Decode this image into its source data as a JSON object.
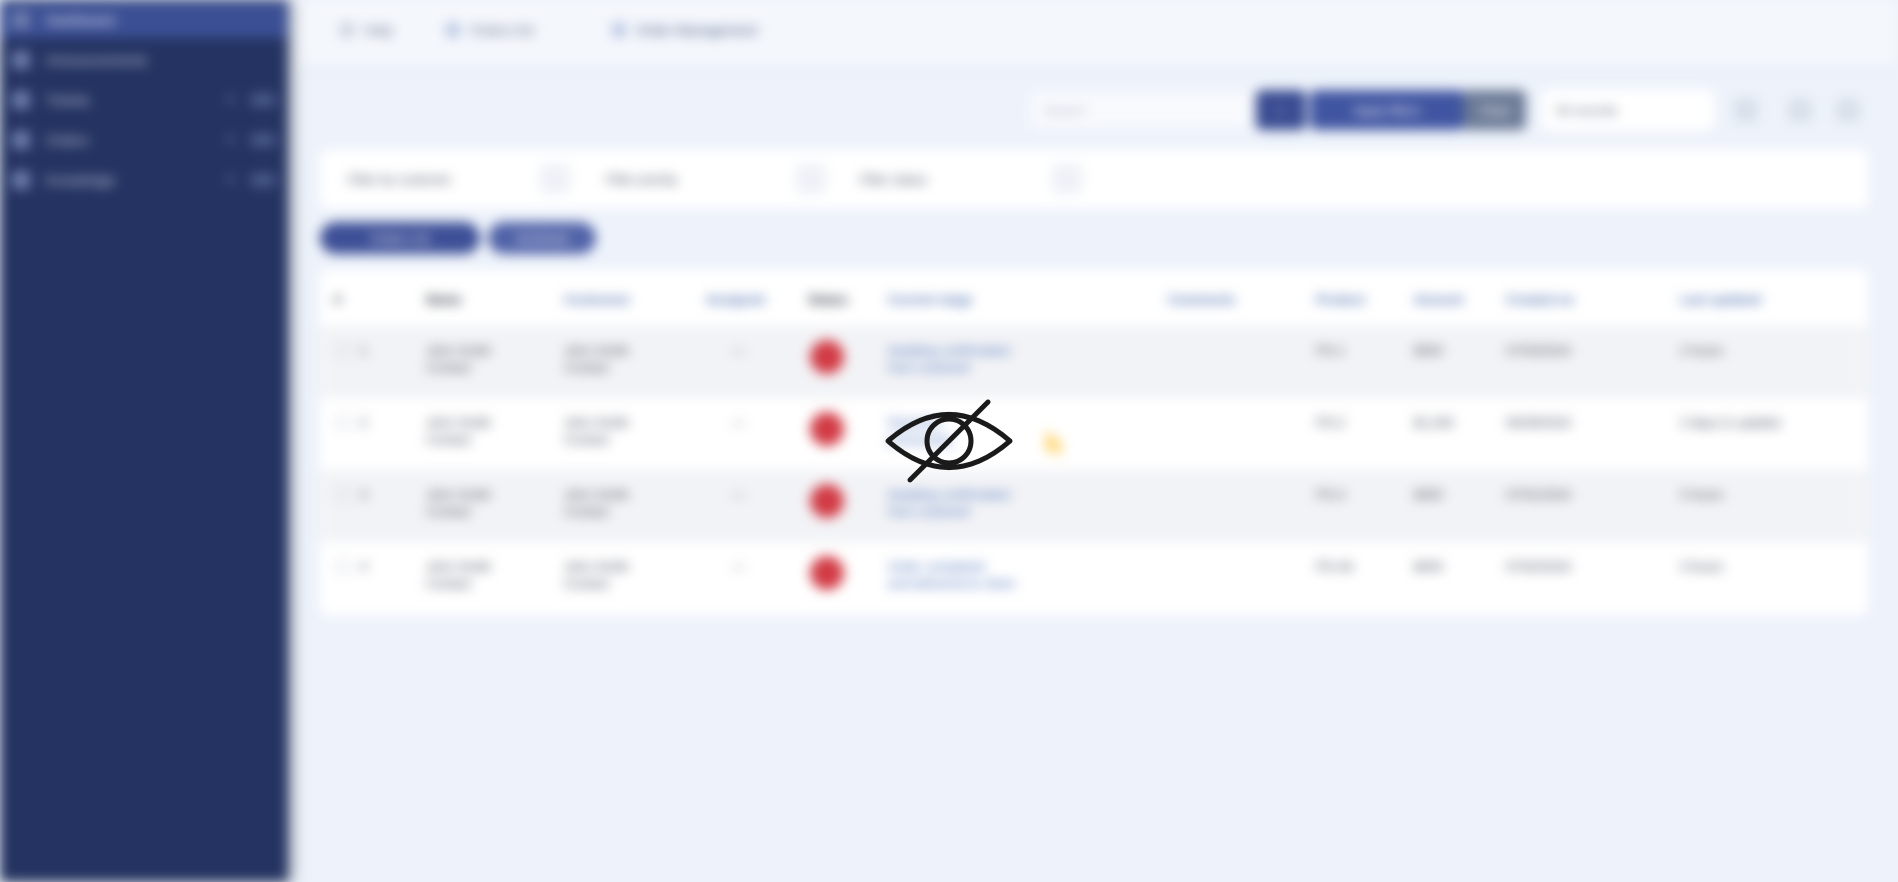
{
  "sidebar": {
    "items": [
      {
        "label": "Dashboard",
        "active": true
      },
      {
        "label": "Announcements",
        "active": false
      },
      {
        "label": "Tickets",
        "active": false
      },
      {
        "label": "Orders",
        "active": false
      },
      {
        "label": "Knowledge",
        "active": false
      }
    ]
  },
  "breadcrumb": {
    "home": "Help",
    "section": "Orders list",
    "current": "Order Management"
  },
  "toolbar": {
    "search_placeholder": "Search",
    "filter_label": "Apply filters",
    "clear_label": "Clear",
    "records_select": "50 records"
  },
  "filters": {
    "customer": "Filter by customer",
    "priority": "Filter priority",
    "status": "Filter status"
  },
  "tabs": {
    "active": "Orders (4)",
    "other": "Archived"
  },
  "table": {
    "headers": [
      "#",
      "Name",
      "Contractor",
      "Assigned",
      "Status",
      "Current stage",
      "Comments",
      "Product",
      "Amount",
      "Created on",
      "Last updated"
    ],
    "rows": [
      {
        "num": "1",
        "name": [
          "John Smith",
          "Contact"
        ],
        "contractor": [
          "John Smith",
          "Contact"
        ],
        "assigned": "—",
        "stage": [
          "Awaiting confirmation",
          "from customer"
        ],
        "product": "PS-1",
        "amount": "$500",
        "created": "07/03/2024",
        "updated": "2 hours"
      },
      {
        "num": "2",
        "name": [
          "John Smith",
          "Contact"
        ],
        "contractor": [
          "John Smith",
          "Contact"
        ],
        "assigned": "—",
        "stage": [
          "Payment",
          "processing"
        ],
        "product": "PS-2",
        "amount": "$1,200",
        "created": "06/28/2024",
        "updated": "2 days (1 update)"
      },
      {
        "num": "3",
        "name": [
          "John Smith",
          "Contact"
        ],
        "contractor": [
          "John Smith",
          "Contact"
        ],
        "assigned": "—",
        "stage": [
          "Awaiting confirmation",
          "from customer"
        ],
        "product": "PS-3",
        "amount": "$300",
        "created": "07/01/2024",
        "updated": "5 hours"
      },
      {
        "num": "4",
        "name": [
          "John Smith",
          "Contact"
        ],
        "contractor": [
          "John Smith",
          "Contact"
        ],
        "assigned": "—",
        "stage": [
          "Order completed",
          "and delivered to client"
        ],
        "product": "PS-4A",
        "amount": "$450",
        "created": "07/02/2024",
        "updated": "3 hours"
      }
    ]
  },
  "colors": {
    "sidebar": "#243361",
    "accent": "#3d4f97",
    "status_red": "#d23b45",
    "background": "#eef3fb"
  },
  "overlay": {
    "icon": "eye-slash-icon"
  }
}
